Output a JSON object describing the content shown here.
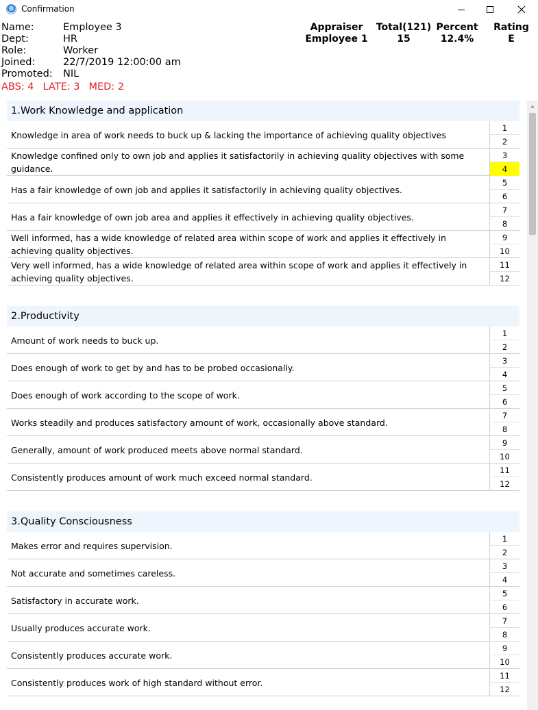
{
  "window": {
    "title": "Confirmation"
  },
  "employee": {
    "rows": [
      {
        "label": "Name:",
        "value": "Employee 3"
      },
      {
        "label": "Dept:",
        "value": "HR"
      },
      {
        "label": "Role:",
        "value": "Worker"
      },
      {
        "label": "Joined:",
        "value": "22/7/2019 12:00:00 am"
      },
      {
        "label": "Promoted:",
        "value": "NIL"
      }
    ],
    "flags": [
      "ABS: 4",
      "LATE: 3",
      "MED: 2"
    ]
  },
  "stats": {
    "appraiser_label": "Appraiser",
    "appraiser_value": "Employee 1",
    "total_label": "Total(121)",
    "total_value": "15",
    "percent_label": "Percent",
    "percent_value": "12.4%",
    "rating_label": "Rating",
    "rating_value": "E"
  },
  "colors": {
    "selected": "#ffff00",
    "header_bg": "#eef5fc",
    "flag_text": "#e02020"
  },
  "sections": [
    {
      "title": "1.Work Knowledge and application",
      "selected_score": 4,
      "rows": [
        {
          "text": "Knowledge in area of work needs to buck up & lacking the importance of achieving quality objectives",
          "scores": [
            "1",
            "2"
          ]
        },
        {
          "text": "Knowledge confined only to own job and applies it satisfactorily in achieving quality objectives with some guidance.",
          "scores": [
            "3",
            "4"
          ]
        },
        {
          "text": "Has a fair knowledge of own job and applies it satisfactorily in achieving quality objectives.",
          "scores": [
            "5",
            "6"
          ]
        },
        {
          "text": "Has a fair knowledge of own job area and applies it effectively in achieving quality objectives.",
          "scores": [
            "7",
            "8"
          ]
        },
        {
          "text": "Well informed, has a wide knowledge of related area within scope of work and applies it effectively in achieving quality objectives.",
          "scores": [
            "9",
            "10"
          ]
        },
        {
          "text": "Very well informed, has a wide knowledge of related area within scope of work and applies it effectively in achieving quality objectives.",
          "scores": [
            "11",
            "12"
          ]
        }
      ]
    },
    {
      "title": "2.Productivity",
      "selected_score": null,
      "rows": [
        {
          "text": "Amount of work needs to buck up.",
          "scores": [
            "1",
            "2"
          ]
        },
        {
          "text": "Does enough of work to get by and has to be probed occasionally.",
          "scores": [
            "3",
            "4"
          ]
        },
        {
          "text": "Does enough of work according to the scope of work.",
          "scores": [
            "5",
            "6"
          ]
        },
        {
          "text": "Works steadily and produces satisfactory amount of work, occasionally above standard.",
          "scores": [
            "7",
            "8"
          ]
        },
        {
          "text": "Generally, amount of work produced meets above normal standard.",
          "scores": [
            "9",
            "10"
          ]
        },
        {
          "text": "Consistently produces amount of work much exceed normal standard.",
          "scores": [
            "11",
            "12"
          ]
        }
      ]
    },
    {
      "title": "3.Quality Consciousness",
      "selected_score": null,
      "rows": [
        {
          "text": "Makes error and requires supervision.",
          "scores": [
            "1",
            "2"
          ]
        },
        {
          "text": "Not accurate and sometimes careless.",
          "scores": [
            "3",
            "4"
          ]
        },
        {
          "text": "Satisfactory in accurate work.",
          "scores": [
            "5",
            "6"
          ]
        },
        {
          "text": "Usually produces accurate work.",
          "scores": [
            "7",
            "8"
          ]
        },
        {
          "text": "Consistently produces accurate work.",
          "scores": [
            "9",
            "10"
          ]
        },
        {
          "text": "Consistently produces work of high standard without error.",
          "scores": [
            "11",
            "12"
          ]
        }
      ]
    }
  ]
}
